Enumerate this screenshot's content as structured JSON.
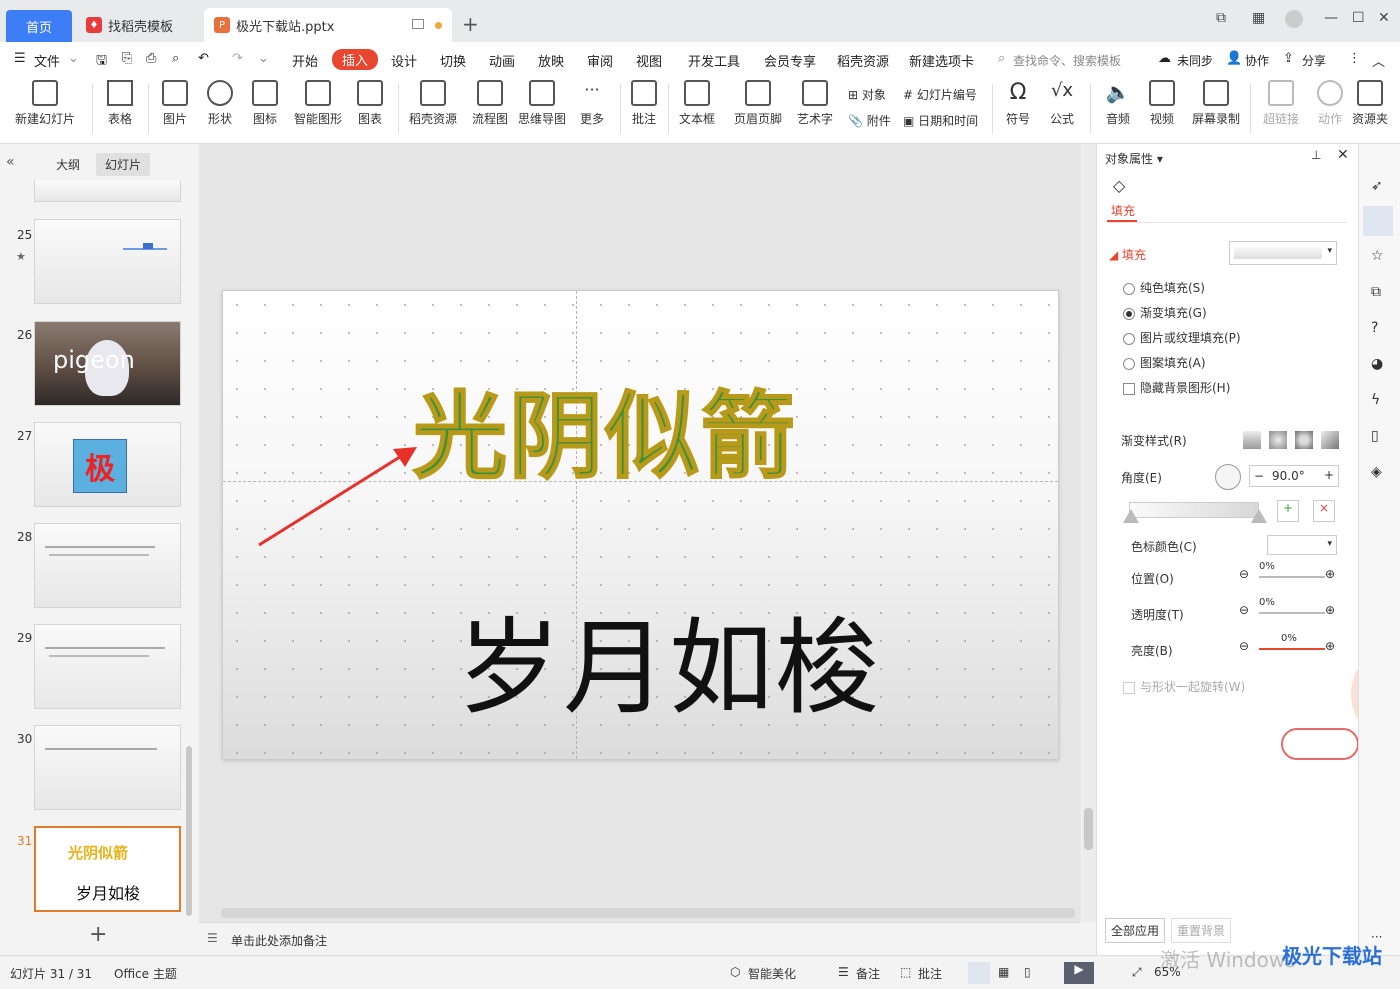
{
  "tabs": {
    "home": "首页",
    "templates": "找稻壳模板",
    "document": "极光下载站.pptx"
  },
  "menu": {
    "file": "文件",
    "items": [
      "开始",
      "插入",
      "设计",
      "切换",
      "动画",
      "放映",
      "审阅",
      "视图",
      "开发工具",
      "会员专享",
      "稻壳资源",
      "新建选项卡"
    ],
    "search": "查找命令、搜索模板",
    "sync": "未同步",
    "collab": "协作",
    "share": "分享"
  },
  "ribbon": {
    "new_slide": "新建幻灯片",
    "table": "表格",
    "picture": "图片",
    "shape": "形状",
    "icon": "图标",
    "smart_shape": "智能图形",
    "chart": "图表",
    "docer": "稻壳资源",
    "flow": "流程图",
    "mind": "思维导图",
    "more": "更多",
    "comment": "批注",
    "textbox": "文本框",
    "header_footer": "页眉页脚",
    "wordart": "艺术字",
    "object": "对象",
    "slide_number": "幻灯片编号",
    "attachment": "附件",
    "datetime": "日期和时间",
    "symbol": "符号",
    "formula": "公式",
    "audio": "音频",
    "video": "视频",
    "screen_record": "屏幕录制",
    "hyperlink": "超链接",
    "action": "动作",
    "resource": "资源夹"
  },
  "left": {
    "outline": "大纲",
    "slides": "幻灯片",
    "thumbs": [
      {
        "n": "25"
      },
      {
        "n": "26",
        "text": "pigeon"
      },
      {
        "n": "27",
        "text": "极"
      },
      {
        "n": "28"
      },
      {
        "n": "29"
      },
      {
        "n": "30"
      },
      {
        "n": "31",
        "title": "光阴似箭",
        "sub": "岁月如梭"
      }
    ]
  },
  "slide": {
    "title": "光阴似箭",
    "subtitle": "岁月如梭"
  },
  "notes": "单击此处添加备注",
  "props": {
    "header": "对象属性",
    "tab": "填充",
    "section": "填充",
    "opts": [
      "纯色填充(S)",
      "渐变填充(G)",
      "图片或纹理填充(P)",
      "图案填充(A)"
    ],
    "hide_bg": "隐藏背景图形(H)",
    "gradient_style": "渐变样式(R)",
    "angle": "角度(E)",
    "angle_value": "90.0°",
    "stop_color": "色标颜色(C)",
    "position": "位置(O)",
    "transparency": "透明度(T)",
    "brightness": "亮度(B)",
    "pct": "0%",
    "rotate_with": "与形状一起旋转(W)",
    "apply_all": "全部应用",
    "reset_bg": "重置背景"
  },
  "status": {
    "slide": "幻灯片 31 / 31",
    "theme": "Office 主题",
    "beautify": "智能美化",
    "notes": "备注",
    "comment": "批注",
    "zoom": "65%",
    "watermark": "激活 Windows",
    "brand": "极光下载站"
  },
  "colors": {
    "accent": "#3d7ef6",
    "insert": "#e8462f",
    "title_fill": "#3f8f3a",
    "title_outline": "#b89a1a",
    "selected": "#e07b2c"
  }
}
